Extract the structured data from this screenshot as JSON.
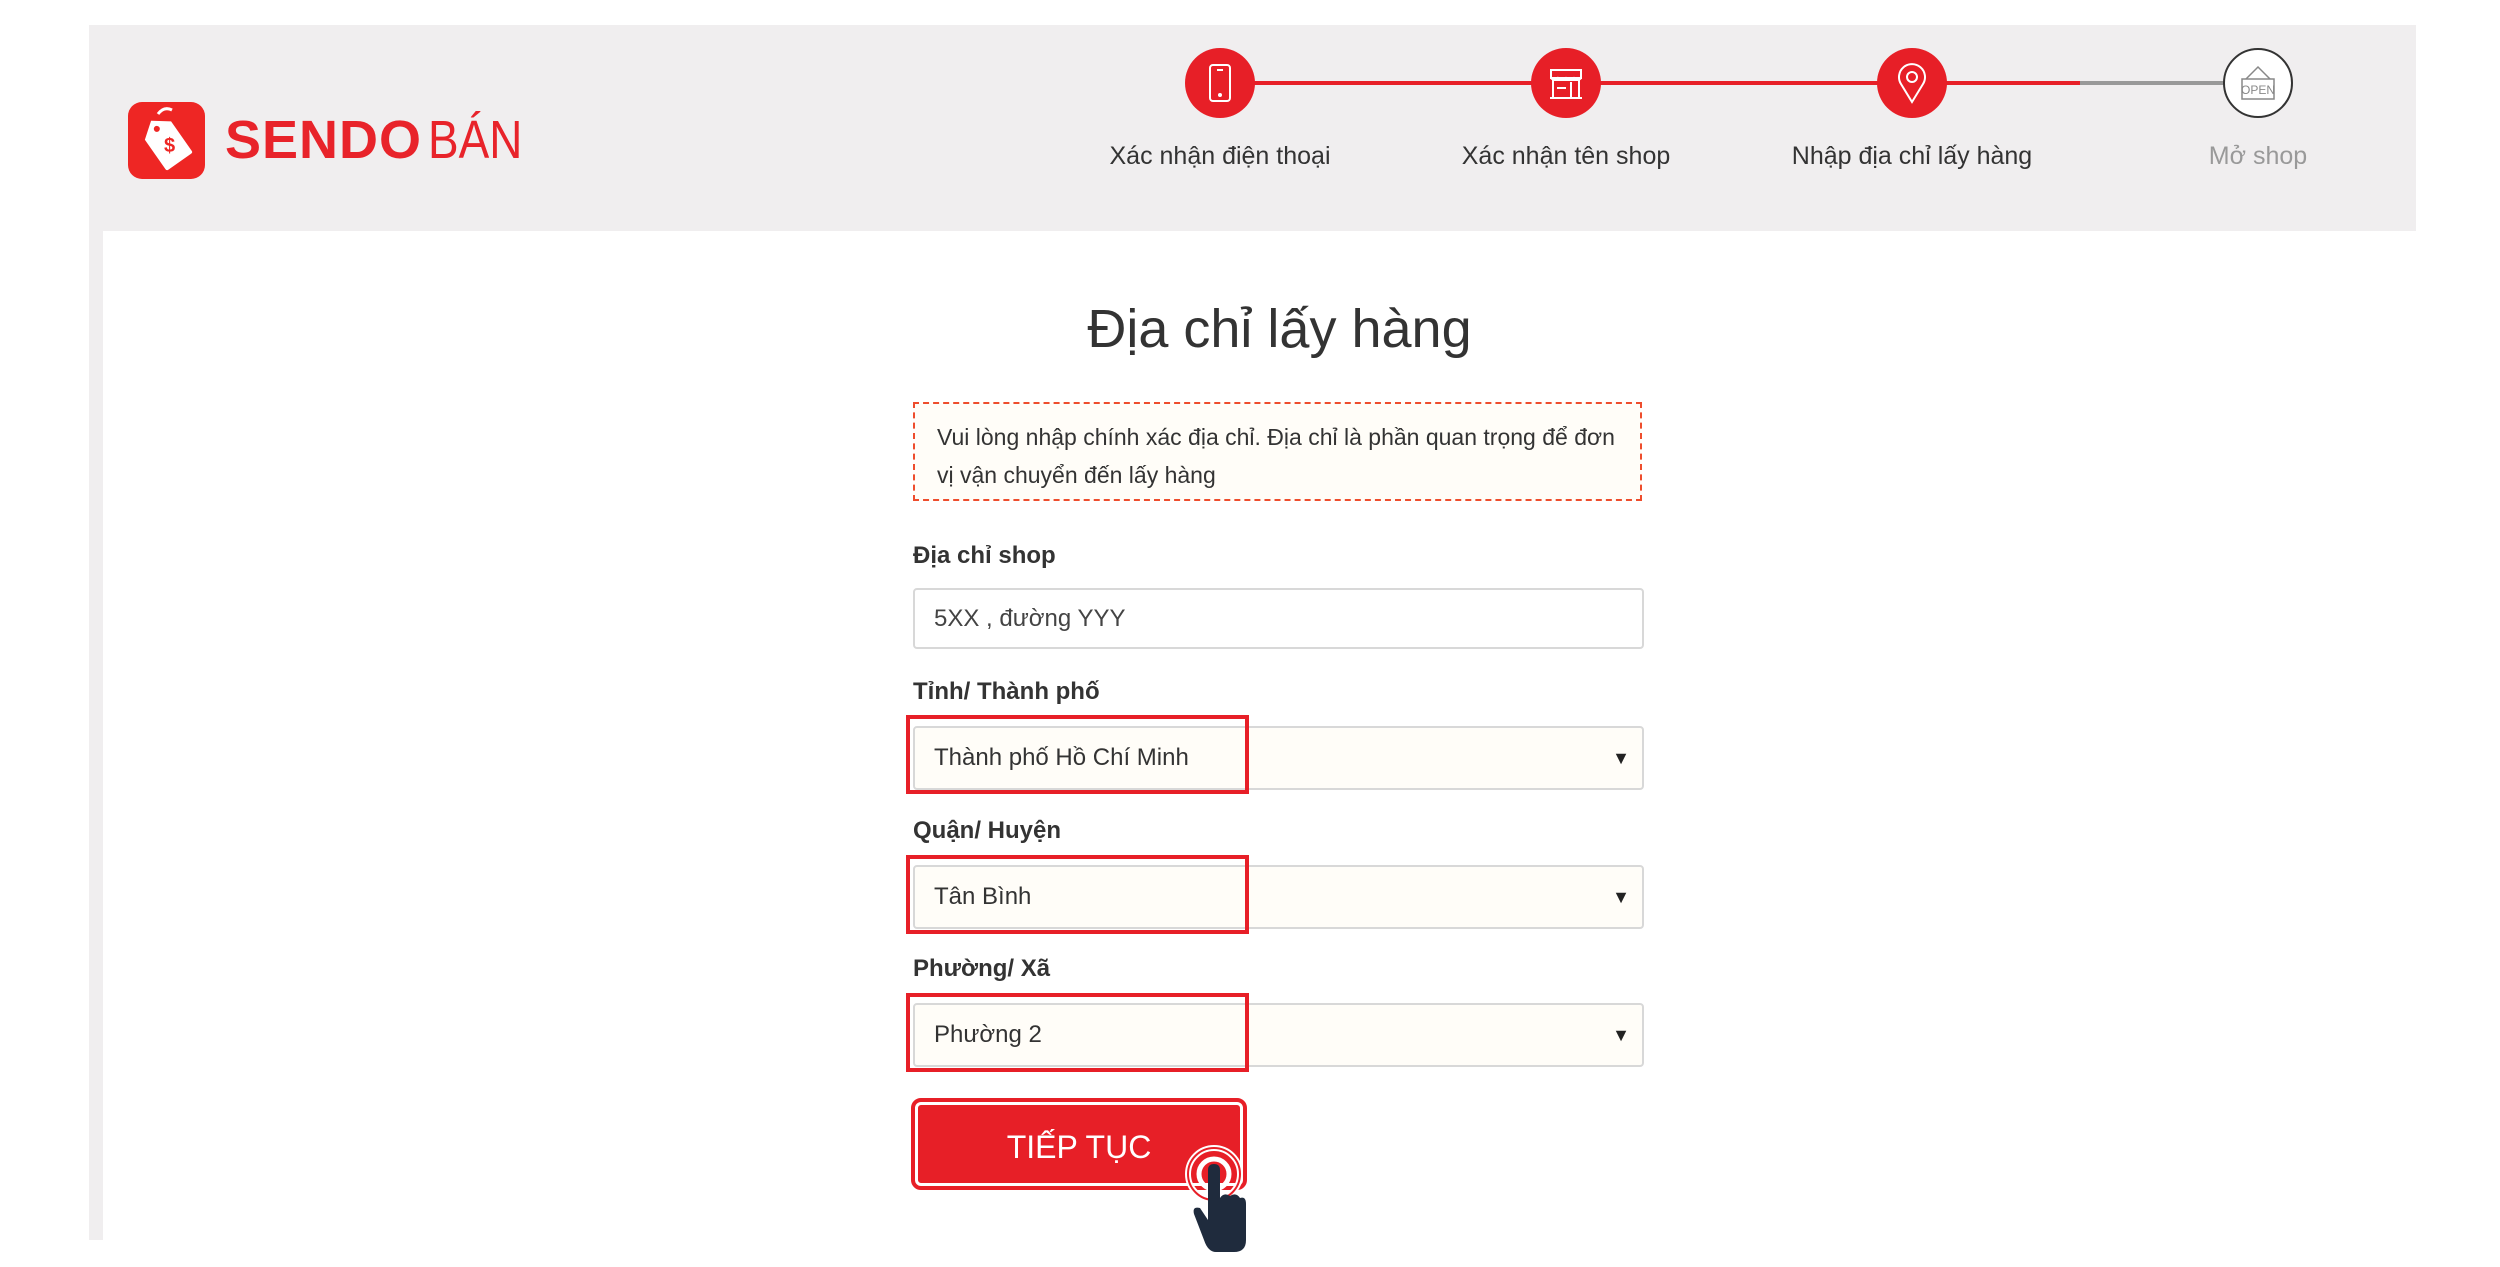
{
  "brand": {
    "name": "SENDO",
    "suffix": "BÁN",
    "icon": "sendo-tag-logo-icon",
    "color": "#e71f27"
  },
  "stepper": {
    "steps": [
      {
        "label": "Xác nhận điện thoại",
        "icon": "phone-icon",
        "status": "done"
      },
      {
        "label": "Xác nhận tên shop",
        "icon": "store-icon",
        "status": "done"
      },
      {
        "label": "Nhập địa chỉ lấy hàng",
        "icon": "location-pin-icon",
        "status": "current"
      },
      {
        "label": "Mở shop",
        "icon": "open-sign-icon",
        "status": "pending"
      }
    ],
    "active_color": "#e71f27",
    "pending_color": "#999999"
  },
  "form": {
    "title": "Địa chỉ lấy hàng",
    "notice": "Vui lòng nhập chính xác địa chỉ. Địa chỉ là phần quan trọng để đơn vị vận chuyển đến lấy hàng",
    "address": {
      "label": "Địa chỉ shop",
      "value": "5XX , đường YYY"
    },
    "province": {
      "label": "Tỉnh/ Thành phố",
      "value": "Thành phố Hồ Chí Minh"
    },
    "district": {
      "label": "Quận/ Huyện",
      "value": "Tân Bình"
    },
    "ward": {
      "label": "Phường/ Xã",
      "value": "Phường 2"
    },
    "submit_label": "TIẾP TỤC"
  }
}
